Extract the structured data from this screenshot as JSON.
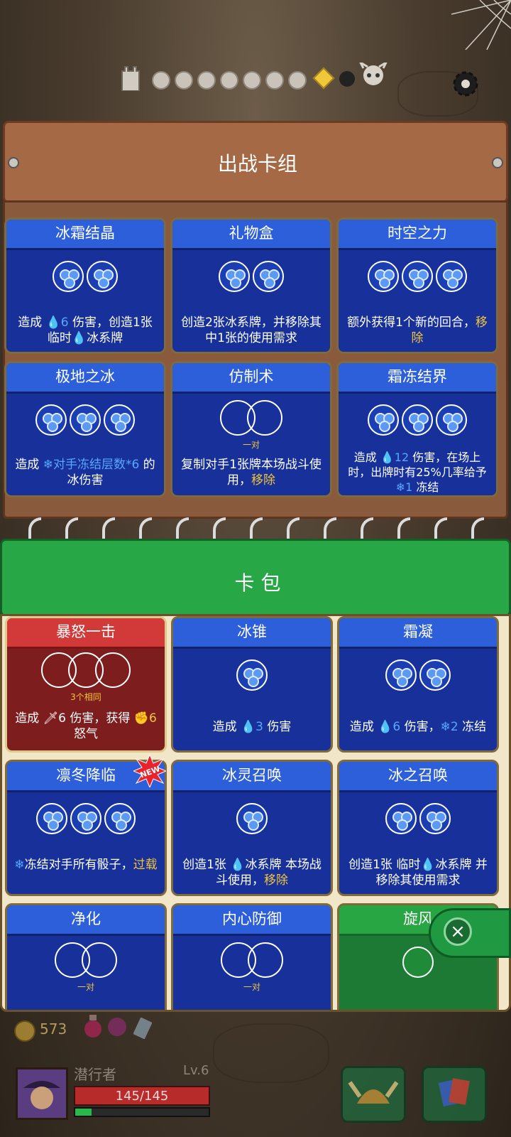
{
  "deck": {
    "title": "出战卡组",
    "cards": [
      {
        "name": "冰霜结晶",
        "desc_parts": [
          "造成 ",
          "💧6",
          " 伤害，创造1张 临时",
          "💧",
          "冰系牌"
        ]
      },
      {
        "name": "礼物盒",
        "desc": "创造2张冰系牌，并移除其中1张的使用需求"
      },
      {
        "name": "时空之力",
        "desc_a": "额外获得1个新的回合，",
        "desc_hl": "移除"
      },
      {
        "name": "极地之冰",
        "desc_a": "造成 ",
        "desc_bl": "❄对手冻结层数*6",
        "desc_b": " 的冰伤害"
      },
      {
        "name": "仿制术",
        "sub": "一对",
        "desc_a": "复制对手1张牌本场战斗使用，",
        "desc_hl": "移除"
      },
      {
        "name": "霜冻结界",
        "desc_a": "造成 ",
        "desc_bl": "💧12",
        "desc_b": " 伤害，在场上时，出牌时有25%几率给予",
        "desc_bl2": "❄1",
        "desc_c": " 冻结"
      }
    ]
  },
  "pack": {
    "title": "卡 包",
    "cards": [
      {
        "name": "暴怒一击",
        "sub": "3个相同",
        "desc_a": "造成 ",
        "desc_b": "🗡6",
        "desc_c": " 伤害，获得 ",
        "desc_d": "✊6",
        "desc_e": " 怒气"
      },
      {
        "name": "冰锥",
        "desc_a": "造成 ",
        "desc_bl": "💧3",
        "desc_b": " 伤害"
      },
      {
        "name": "霜凝",
        "desc_a": "造成 ",
        "desc_bl": "💧6",
        "desc_b": " 伤害，",
        "desc_bl2": "❄2",
        "desc_c": " 冻结"
      },
      {
        "name": "凛冬降临",
        "badge": "NEW",
        "desc_bl": "❄",
        "desc_a": "冻结对手所有骰子，",
        "desc_hl": "过载"
      },
      {
        "name": "冰灵召唤",
        "desc_a": "创造1张 ",
        "desc_bl": "💧",
        "desc_b": "冰系牌 本场战斗使用，",
        "desc_hl": "移除"
      },
      {
        "name": "冰之召唤",
        "desc_a": "创造1张 临时",
        "desc_bl": "💧",
        "desc_b": "冰系牌 并移除其使用需求"
      },
      {
        "name": "净化",
        "sub": "一对"
      },
      {
        "name": "内心防御",
        "sub": "一对"
      },
      {
        "name": "旋风"
      }
    ]
  },
  "player": {
    "gold": "573",
    "name": "潜行者",
    "level": "Lv.6",
    "hp": "145/145",
    "xp_fraction": 0.12
  },
  "icons": {
    "close": "close-icon",
    "settings": "gear-icon"
  }
}
